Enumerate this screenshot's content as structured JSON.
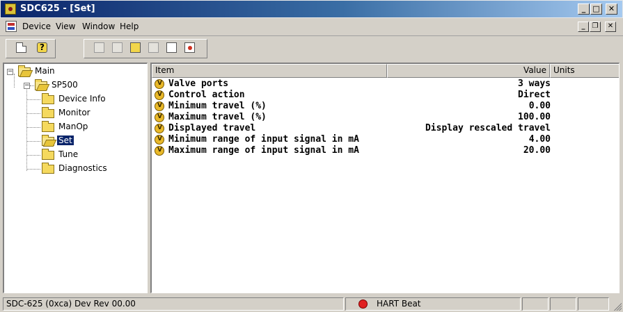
{
  "window": {
    "title": "SDC625 - [Set]",
    "controls": {
      "minimize": "_",
      "maximize": "□",
      "close": "✕"
    }
  },
  "menubar": {
    "items": [
      {
        "label": "Device",
        "mnemonic": "D"
      },
      {
        "label": "View",
        "mnemonic": "V"
      },
      {
        "label": "Window",
        "mnemonic": "W"
      },
      {
        "label": "Help",
        "mnemonic": "H"
      }
    ],
    "mdi_controls": {
      "minimize": "_",
      "restore": "❐",
      "close": "✕"
    }
  },
  "toolbar": {
    "buttons": [
      {
        "icon": "new-document-icon",
        "enabled": true
      },
      {
        "icon": "help-icon",
        "enabled": true
      },
      {
        "icon": "device-read-icon",
        "enabled": false
      },
      {
        "icon": "device-write-icon",
        "enabled": false
      },
      {
        "icon": "device-compare-icon",
        "enabled": true
      },
      {
        "icon": "device-print-icon",
        "enabled": false
      },
      {
        "icon": "device-save-icon",
        "enabled": true
      },
      {
        "icon": "device-load-icon",
        "enabled": true
      }
    ]
  },
  "tree": {
    "nodes": [
      {
        "label": "Main",
        "expanded": true,
        "level": 0
      },
      {
        "label": "SP500",
        "expanded": true,
        "level": 1
      },
      {
        "label": "Device Info",
        "level": 2
      },
      {
        "label": "Monitor",
        "level": 2
      },
      {
        "label": "ManOp",
        "level": 2
      },
      {
        "label": "Set",
        "level": 2,
        "selected": true,
        "open": true
      },
      {
        "label": "Tune",
        "level": 2
      },
      {
        "label": "Diagnostics",
        "level": 2
      }
    ]
  },
  "list": {
    "columns": {
      "item": "Item",
      "value": "Value",
      "units": "Units"
    },
    "rows": [
      {
        "item": "Valve ports",
        "value": "3 ways"
      },
      {
        "item": "Control action",
        "value": "Direct"
      },
      {
        "item": "Minimum travel (%)",
        "value": "0.00"
      },
      {
        "item": "Maximum travel (%)",
        "value": "100.00"
      },
      {
        "item": "Displayed travel",
        "value": "Display rescaled travel"
      },
      {
        "item": "Minimum range of input signal in mA",
        "value": "4.00"
      },
      {
        "item": "Maximum range of input signal in mA",
        "value": "20.00"
      }
    ]
  },
  "statusbar": {
    "device": "SDC-625  (0xca) Dev Rev 00.00",
    "heartbeat": "HART Beat",
    "heartbeat_color": "#e02020"
  },
  "colors": {
    "titlebar_start": "#0a246a",
    "titlebar_end": "#a6caf0",
    "selection": "#0a246a",
    "chrome": "#d4d0c8"
  }
}
